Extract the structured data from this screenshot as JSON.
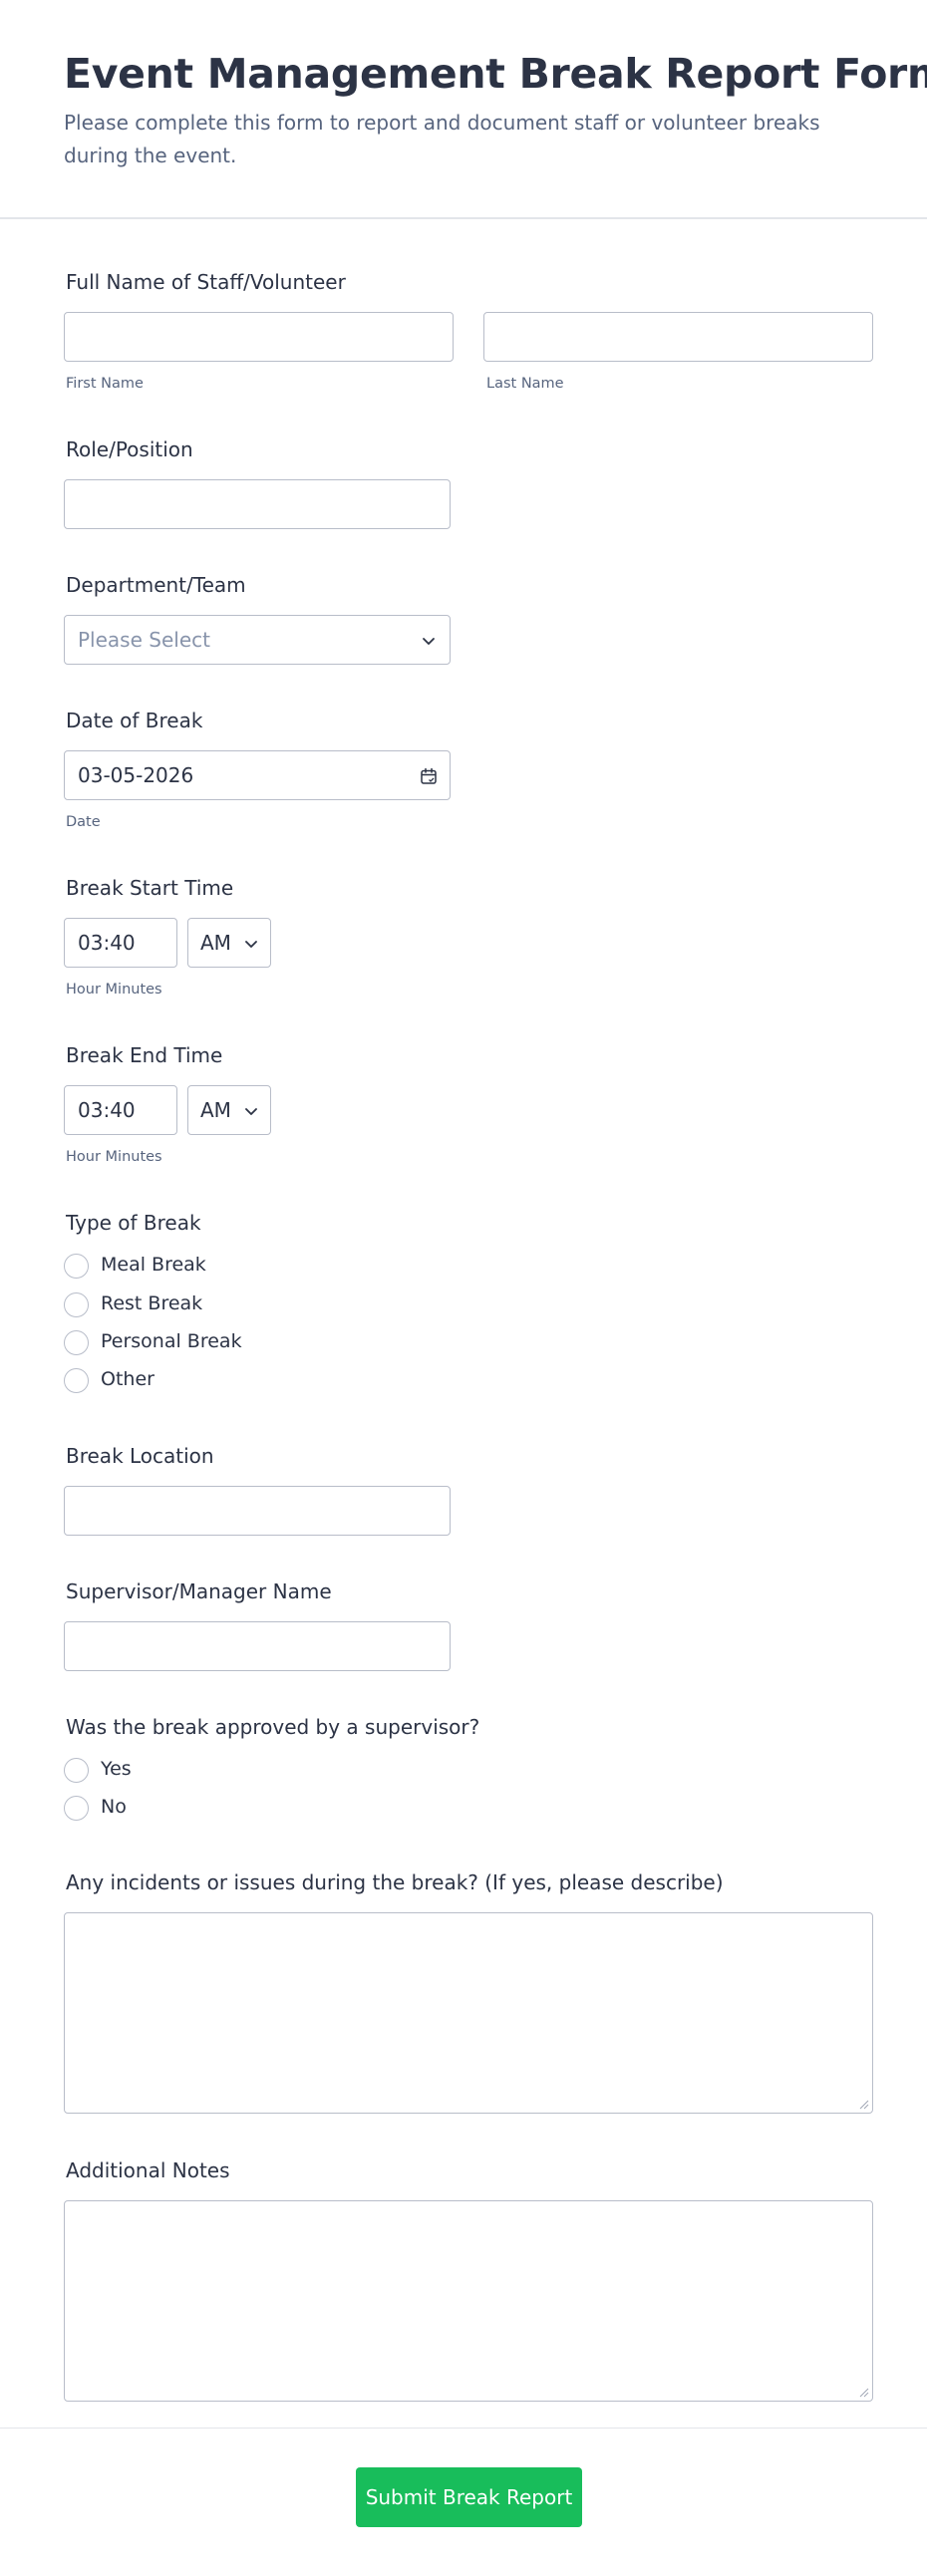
{
  "header": {
    "title": "Event Management Break Report Form",
    "subtitle": "Please complete this form to report and document staff or volunteer breaks during the event."
  },
  "full_name": {
    "label": "Full Name of Staff/Volunteer",
    "first_value": "",
    "last_value": "",
    "first_sublabel": "First Name",
    "last_sublabel": "Last Name"
  },
  "role": {
    "label": "Role/Position",
    "value": ""
  },
  "department": {
    "label": "Department/Team",
    "placeholder": "Please Select",
    "icon": "chevron-down-icon"
  },
  "date": {
    "label": "Date of Break",
    "value": "03-05-2026",
    "sublabel": "Date",
    "icon": "calendar-icon"
  },
  "start_time": {
    "label": "Break Start Time",
    "time": "03:40",
    "ampm": "AM",
    "sublabel": "Hour Minutes"
  },
  "end_time": {
    "label": "Break End Time",
    "time": "03:40",
    "ampm": "AM",
    "sublabel": "Hour Minutes"
  },
  "break_type": {
    "label": "Type of Break",
    "options": [
      "Meal Break",
      "Rest Break",
      "Personal Break",
      "Other"
    ]
  },
  "location": {
    "label": "Break Location",
    "value": ""
  },
  "supervisor": {
    "label": "Supervisor/Manager Name",
    "value": ""
  },
  "approved": {
    "label": "Was the break approved by a supervisor?",
    "options": [
      "Yes",
      "No"
    ]
  },
  "incidents": {
    "label": "Any incidents or issues during the break? (If yes, please describe)",
    "value": ""
  },
  "notes": {
    "label": "Additional Notes",
    "value": ""
  },
  "submit": {
    "label": "Submit Break Report",
    "color": "#18bd5b"
  }
}
